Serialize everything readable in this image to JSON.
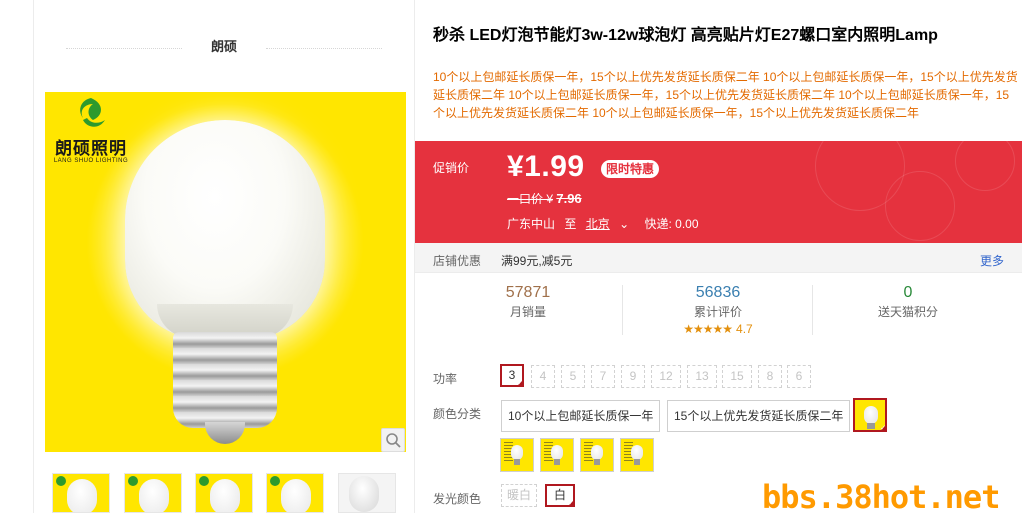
{
  "shop": {
    "name": "朗硕"
  },
  "brand": {
    "cn_name": "朗硕照明",
    "en_name": "LANG SHUO LIGHTING"
  },
  "product": {
    "title": "秒杀 LED灯泡节能灯3w-12w球泡灯 高亮贴片灯E27螺口室内照明Lamp",
    "subtitle": "10个以上包邮延长质保一年，15个以上优先发货延长质保二年 10个以上包邮延长质保一年，15个以上优先发货延长质保二年 10个以上包邮延长质保一年，15个以上优先发货延长质保二年 10个以上包邮延长质保一年，15个以上优先发货延长质保二年 10个以上包邮延长质保一年，15个以上优先发货延长质保二年"
  },
  "price": {
    "promo_label": "促销价",
    "current": "¥1.99",
    "tag": "限时特惠",
    "orig_label": "一口价 ¥",
    "orig_value": "7.96",
    "ship_from": "广东中山",
    "ship_to_label": "至",
    "ship_dest": "北京",
    "ship_caret": "⌄",
    "ship_fee": "快递: 0.00"
  },
  "shop_promo": {
    "label": "店铺优惠",
    "value": "满99元,减5元",
    "more": "更多"
  },
  "stats": [
    {
      "value": "57871",
      "label": "月销量",
      "color": "#a0704a"
    },
    {
      "value": "56836",
      "label": "累计评价",
      "color": "#3a7fb0",
      "stars": "★★★★★",
      "score": "4.7"
    },
    {
      "value": "0",
      "label": "送天猫积分",
      "color": "#2a8a3a"
    }
  ],
  "attributes": {
    "power": {
      "label": "功率",
      "options": [
        "3",
        "4",
        "5",
        "7",
        "9",
        "12",
        "13",
        "15",
        "8",
        "6"
      ],
      "selected": "3"
    },
    "color_category": {
      "label": "颜色分类",
      "options": [
        "10个以上包邮延长质保一年",
        "15个以上优先发货延长质保二年"
      ]
    },
    "light_color": {
      "label": "发光颜色",
      "options": [
        "暖白",
        "白"
      ],
      "selected": "白"
    }
  },
  "icons": {
    "check": "✓",
    "zoom": "magnifier-icon"
  },
  "watermark": "bbs.38hot.net",
  "colors": {
    "promo_bg": "#e5323e",
    "accent": "#b0181f",
    "image_bg": "#ffe600"
  }
}
